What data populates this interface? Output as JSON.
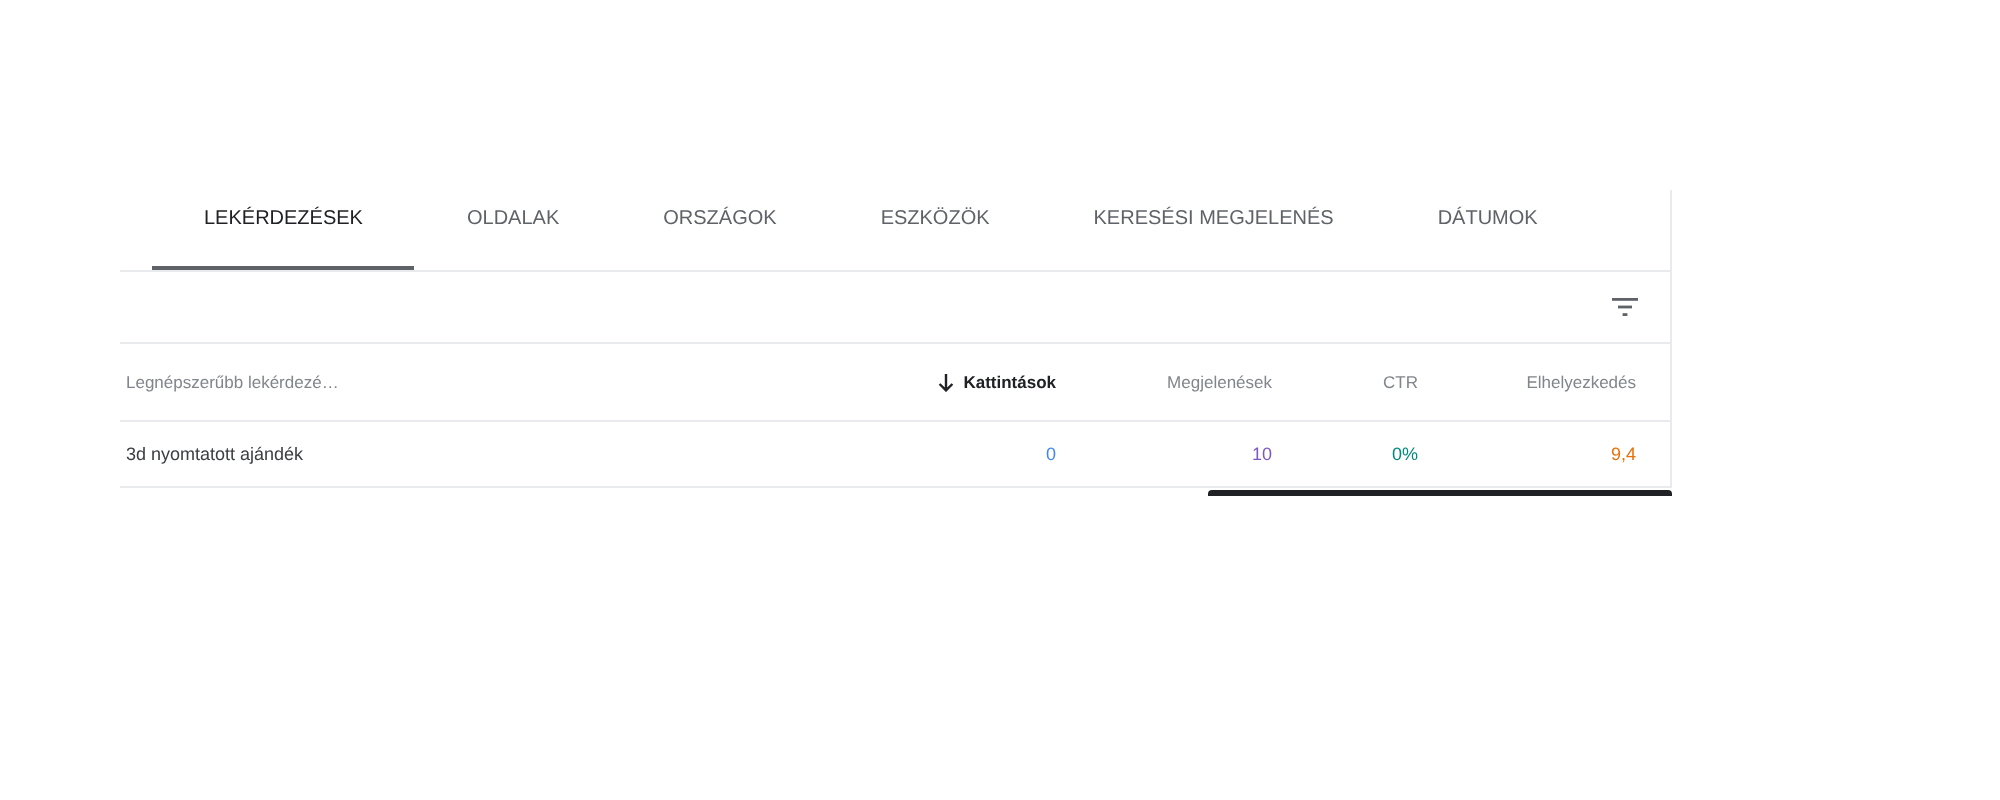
{
  "tabs": [
    {
      "label": "LEKÉRDEZÉSEK",
      "selected": true
    },
    {
      "label": "OLDALAK",
      "selected": false
    },
    {
      "label": "ORSZÁGOK",
      "selected": false
    },
    {
      "label": "ESZKÖZÖK",
      "selected": false
    },
    {
      "label": "KERESÉSI MEGJELENÉS",
      "selected": false
    },
    {
      "label": "DÁTUMOK",
      "selected": false
    }
  ],
  "table": {
    "columns": [
      {
        "label": "Legnépszerűbb lekérdezé…",
        "sorted": false,
        "color": "#3c4043"
      },
      {
        "label": "Kattintások",
        "sorted": true,
        "color": "#4285f4"
      },
      {
        "label": "Megjelenések",
        "sorted": false,
        "color": "#7e57c2"
      },
      {
        "label": "CTR",
        "sorted": false,
        "color": "#00897b"
      },
      {
        "label": "Elhelyezkedés",
        "sorted": false,
        "color": "#e8710a"
      }
    ],
    "rows": [
      [
        "3d nyomtatott ajándék",
        "0",
        "10",
        "0%",
        "9,4"
      ]
    ]
  }
}
